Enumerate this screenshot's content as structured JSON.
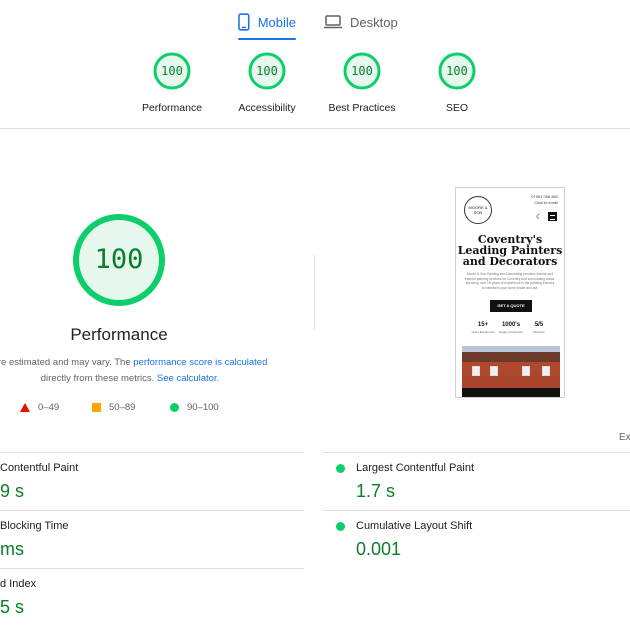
{
  "tabs": [
    {
      "label": "Mobile",
      "active": true,
      "icon": "smartphone-icon"
    },
    {
      "label": "Desktop",
      "active": false,
      "icon": "laptop-icon"
    }
  ],
  "categories": [
    {
      "score": "100",
      "label": "Performance"
    },
    {
      "score": "100",
      "label": "Accessibility"
    },
    {
      "score": "100",
      "label": "Best Practices"
    },
    {
      "score": "100",
      "label": "SEO"
    }
  ],
  "performance": {
    "score": "100",
    "title": "Performance",
    "desc_prefix": "are estimated and may vary. The ",
    "desc_link1": "performance score is calculated",
    "desc_middle": " directly from these metrics. ",
    "desc_link2": "See calculator",
    "desc_suffix": "."
  },
  "legend": [
    {
      "range": "0–49",
      "shape": "triangle",
      "color": "#eb0f00"
    },
    {
      "range": "50–89",
      "shape": "square",
      "color": "#ffa400"
    },
    {
      "range": "90–100",
      "shape": "circle",
      "color": "#0cce6b"
    }
  ],
  "screenshot": {
    "logo_text": "MOORE & SON",
    "phone_line1": "07961 058 860",
    "phone_line2": "Click to email",
    "hero": "Coventry's Leading Painters and Decorators",
    "body": "Moore & Son Painting and Decorating provides interior and exterior painting services for Coventry and surrounding areas. We bring over 15 years of experience in the painting industry to transform your home inside and out.",
    "cta": "GET A QUOTE",
    "stats": [
      {
        "value": "15+",
        "label": "Years Experience"
      },
      {
        "value": "1000's",
        "label": "Happy Customers"
      },
      {
        "value": "5/5",
        "label": "Reviews"
      }
    ]
  },
  "expand_text": "Ex",
  "metrics": {
    "left": [
      {
        "label": "Contentful Paint",
        "value": "9 s"
      },
      {
        "label": "Blocking Time",
        "value": "ms"
      },
      {
        "label": "d Index",
        "value": "5 s"
      }
    ],
    "right": [
      {
        "label": "Largest Contentful Paint",
        "value": "1.7 s"
      },
      {
        "label": "Cumulative Layout Shift",
        "value": "0.001"
      }
    ]
  },
  "colors": {
    "accent": "#1a73e8",
    "pass": "#0cce6b",
    "pass_text": "#0c7d2a",
    "average": "#ffa400",
    "fail": "#eb0f00"
  }
}
